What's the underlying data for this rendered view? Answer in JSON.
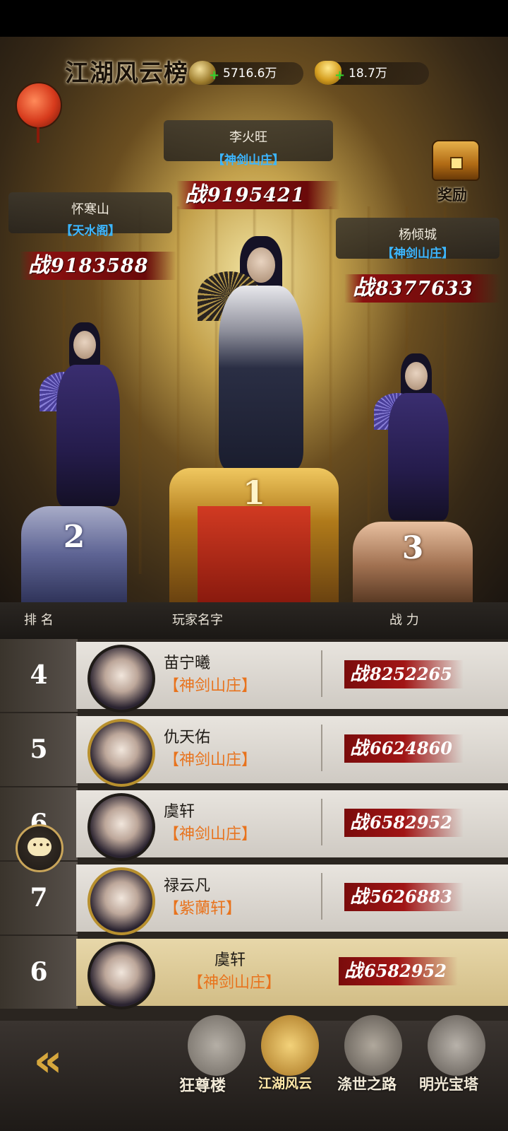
{
  "header": {
    "title": "江湖风云榜",
    "silver": "5716.6万",
    "gold": "18.7万",
    "reward_label": "奖励",
    "plus": "+"
  },
  "top3": [
    {
      "rank": "1",
      "name": "李火旺",
      "guild": "【神剑山庄】",
      "zhan": "战",
      "power": "9195421"
    },
    {
      "rank": "2",
      "name": "怀寒山",
      "guild": "【天水阁】",
      "zhan": "战",
      "power": "9183588"
    },
    {
      "rank": "3",
      "name": "杨倾城",
      "guild": "【神剑山庄】",
      "zhan": "战",
      "power": "8377633"
    }
  ],
  "columns": {
    "rank": "排 名",
    "player": "玩家名字",
    "power": "战 力"
  },
  "rows": [
    {
      "rank": "4",
      "name": "苗宁曦",
      "guild": "【神剑山庄】",
      "zhan": "战",
      "power": "8252265"
    },
    {
      "rank": "5",
      "name": "仇天佑",
      "guild": "【神剑山庄】",
      "zhan": "战",
      "power": "6624860"
    },
    {
      "rank": "6",
      "name": "虞轩",
      "guild": "【神剑山庄】",
      "zhan": "战",
      "power": "6582952"
    },
    {
      "rank": "7",
      "name": "禄云凡",
      "guild": "【紫蘭轩】",
      "zhan": "战",
      "power": "5626883"
    }
  ],
  "self_row": {
    "rank": "6",
    "name": "虞轩",
    "guild": "【神剑山庄】",
    "zhan": "战",
    "power": "6582952"
  },
  "tabs": [
    {
      "label": "狂尊楼"
    },
    {
      "label": "江湖风云"
    },
    {
      "label": "涤世之路"
    },
    {
      "label": "明光宝塔"
    }
  ],
  "icons": {
    "back": "back-arrow-icon",
    "chat": "chat-icon",
    "chest": "treasure-chest-icon",
    "silver": "coin-icon",
    "gold": "gold-ingot-icon"
  },
  "colors": {
    "power_red": "#8a1010",
    "guild_blue": "#3cb6ff",
    "guild_orange": "#e8731d",
    "accent_gold": "#d6a73d"
  }
}
